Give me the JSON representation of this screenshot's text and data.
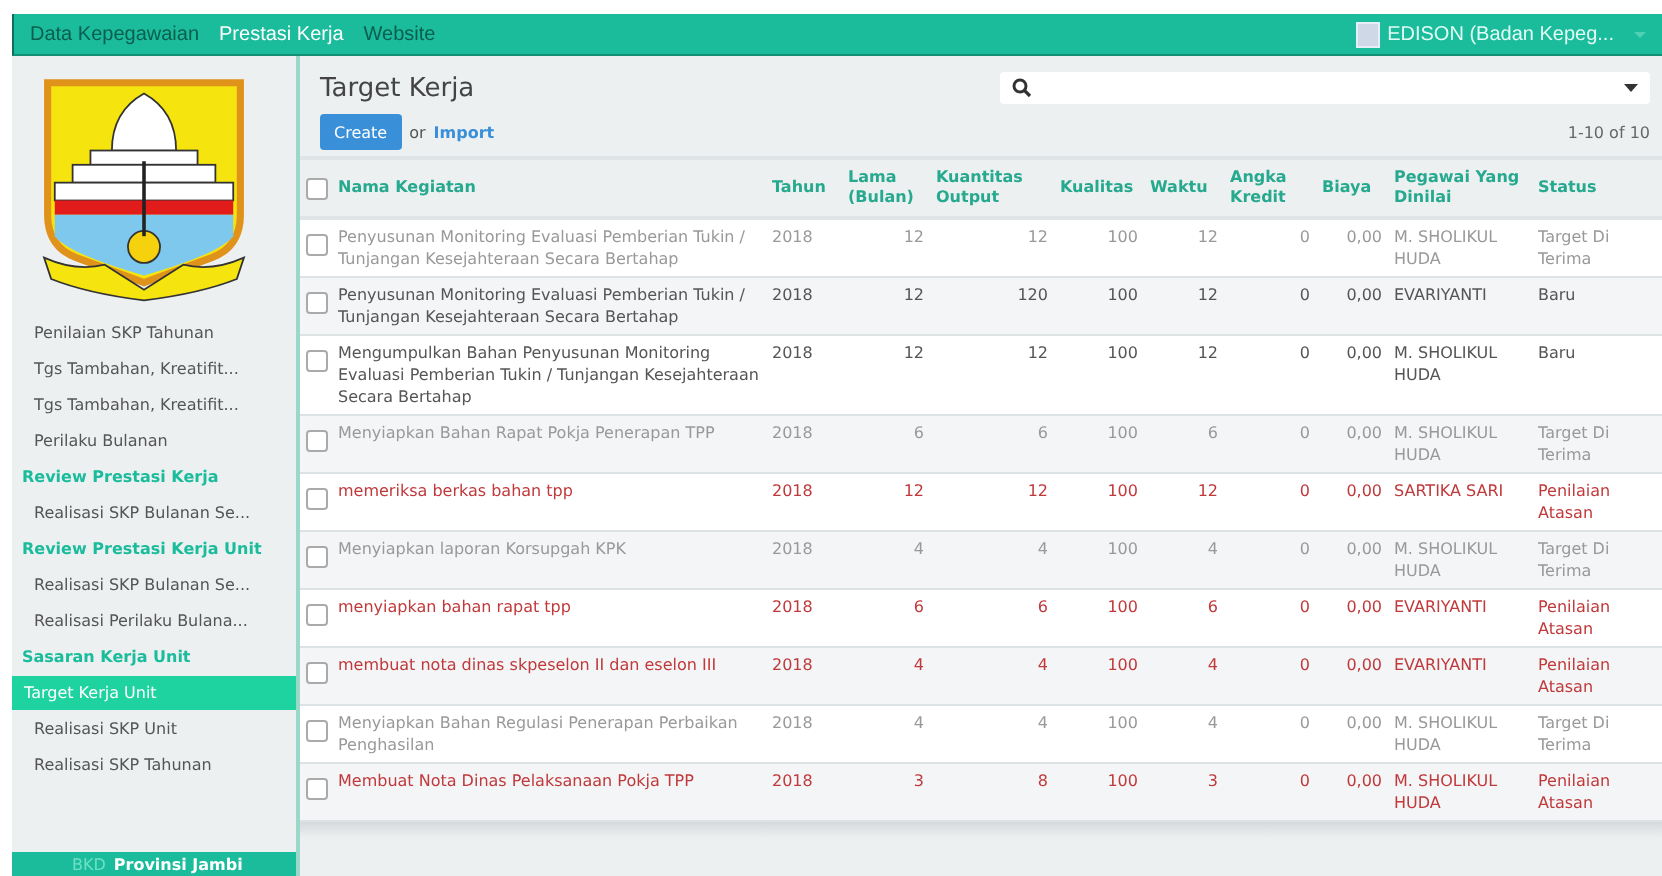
{
  "topbar": {
    "menu": [
      {
        "label": "Data Kepegawaian",
        "selected": false
      },
      {
        "label": "Prestasi Kerja",
        "selected": true
      },
      {
        "label": "Website",
        "selected": false
      }
    ],
    "user": "EDISON (Badan Kepeg..."
  },
  "sidebar": {
    "items": [
      {
        "kind": "link",
        "label": "Penilaian SKP Tahunan",
        "selected": false
      },
      {
        "kind": "link",
        "label": "Tgs Tambahan, Kreatifit...",
        "selected": false
      },
      {
        "kind": "link",
        "label": "Tgs Tambahan, Kreatifit...",
        "selected": false
      },
      {
        "kind": "link",
        "label": "Perilaku Bulanan",
        "selected": false
      },
      {
        "kind": "header",
        "label": "Review Prestasi Kerja"
      },
      {
        "kind": "link",
        "label": "Realisasi SKP Bulanan Se...",
        "selected": false
      },
      {
        "kind": "header",
        "label": "Review Prestasi Kerja Unit"
      },
      {
        "kind": "link",
        "label": "Realisasi SKP Bulanan Se...",
        "selected": false
      },
      {
        "kind": "link",
        "label": "Realisasi Perilaku Bulana...",
        "selected": false
      },
      {
        "kind": "header",
        "label": "Sasaran Kerja Unit"
      },
      {
        "kind": "link",
        "label": "Target Kerja Unit",
        "selected": true
      },
      {
        "kind": "link",
        "label": "Realisasi SKP Unit",
        "selected": false
      },
      {
        "kind": "link",
        "label": "Realisasi SKP Tahunan",
        "selected": false
      }
    ],
    "footer": {
      "org": "BKD",
      "region": "Provinsi Jambi"
    }
  },
  "main": {
    "title": "Target Kerja",
    "create": "Create",
    "or": "or",
    "import": "Import",
    "pager": "1-10 of 10",
    "table": {
      "columns": [
        "Nama Kegiatan",
        "Tahun",
        "Lama (Bulan)",
        "Kuantitas Output",
        "Kualitas",
        "Waktu",
        "Angka Kredit",
        "Biaya",
        "Pegawai Yang Dinilai",
        "Status"
      ],
      "all_checked": false,
      "rows": [
        {
          "kind": "accepted",
          "checked": false,
          "cells": [
            "Penyusunan Monitoring Evaluasi Pemberian Tukin / Tunjangan Kesejahteraan Secara Bertahap",
            "2018",
            "12",
            "12",
            "100",
            "12",
            "0",
            "0,00",
            "M. SHOLIKUL HUDA",
            "Target Di Terima"
          ]
        },
        {
          "kind": "new",
          "checked": false,
          "cells": [
            "Penyusunan Monitoring Evaluasi Pemberian Tukin / Tunjangan Kesejahteraan Secara Bertahap",
            "2018",
            "12",
            "120",
            "100",
            "12",
            "0",
            "0,00",
            "EVARIYANTI",
            "Baru"
          ]
        },
        {
          "kind": "new",
          "checked": false,
          "cells": [
            "Mengumpulkan Bahan Penyusunan Monitoring Evaluasi Pemberian Tukin / Tunjangan Kesejahteraan Secara Bertahap",
            "2018",
            "12",
            "12",
            "100",
            "12",
            "0",
            "0,00",
            "M. SHOLIKUL HUDA",
            "Baru"
          ]
        },
        {
          "kind": "accepted",
          "checked": false,
          "cells": [
            "Menyiapkan Bahan Rapat Pokja Penerapan TPP",
            "2018",
            "6",
            "6",
            "100",
            "6",
            "0",
            "0,00",
            "M. SHOLIKUL HUDA",
            "Target Di Terima"
          ]
        },
        {
          "kind": "review",
          "checked": false,
          "cells": [
            "memeriksa berkas bahan tpp",
            "2018",
            "12",
            "12",
            "100",
            "12",
            "0",
            "0,00",
            "SARTIKA SARI",
            "Penilaian Atasan"
          ]
        },
        {
          "kind": "accepted",
          "checked": false,
          "cells": [
            "Menyiapkan laporan Korsupgah KPK",
            "2018",
            "4",
            "4",
            "100",
            "4",
            "0",
            "0,00",
            "M. SHOLIKUL HUDA",
            "Target Di Terima"
          ]
        },
        {
          "kind": "review",
          "checked": false,
          "cells": [
            "menyiapkan bahan rapat tpp",
            "2018",
            "6",
            "6",
            "100",
            "6",
            "0",
            "0,00",
            "EVARIYANTI",
            "Penilaian Atasan"
          ]
        },
        {
          "kind": "review",
          "checked": false,
          "cells": [
            "membuat nota dinas skpeselon II dan eselon III",
            "2018",
            "4",
            "4",
            "100",
            "4",
            "0",
            "0,00",
            "EVARIYANTI",
            "Penilaian Atasan"
          ]
        },
        {
          "kind": "accepted",
          "checked": false,
          "cells": [
            "Menyiapkan Bahan Regulasi Penerapan Perbaikan Penghasilan",
            "2018",
            "4",
            "4",
            "100",
            "4",
            "0",
            "0,00",
            "M. SHOLIKUL HUDA",
            "Target Di Terima"
          ]
        },
        {
          "kind": "review",
          "checked": false,
          "cells": [
            "Membuat Nota Dinas Pelaksanaan Pokja TPP",
            "2018",
            "3",
            "8",
            "100",
            "3",
            "0",
            "0,00",
            "M. SHOLIKUL HUDA",
            "Penilaian Atasan"
          ]
        }
      ]
    }
  }
}
